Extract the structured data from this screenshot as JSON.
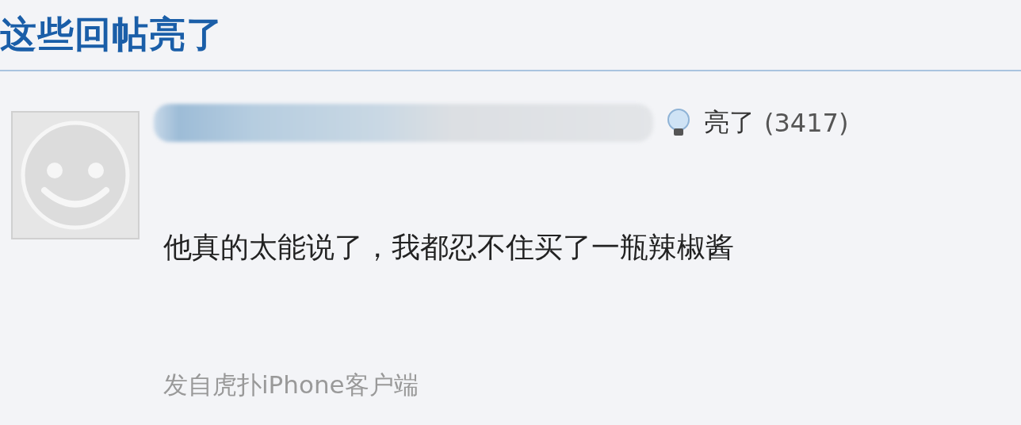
{
  "section_title": "这些回帖亮了",
  "post": {
    "light_label": "亮了",
    "light_count": "(3417)",
    "text": "他真的太能说了，我都忍不住买了一瓶辣椒酱",
    "source": "发自虎扑iPhone客户端"
  }
}
